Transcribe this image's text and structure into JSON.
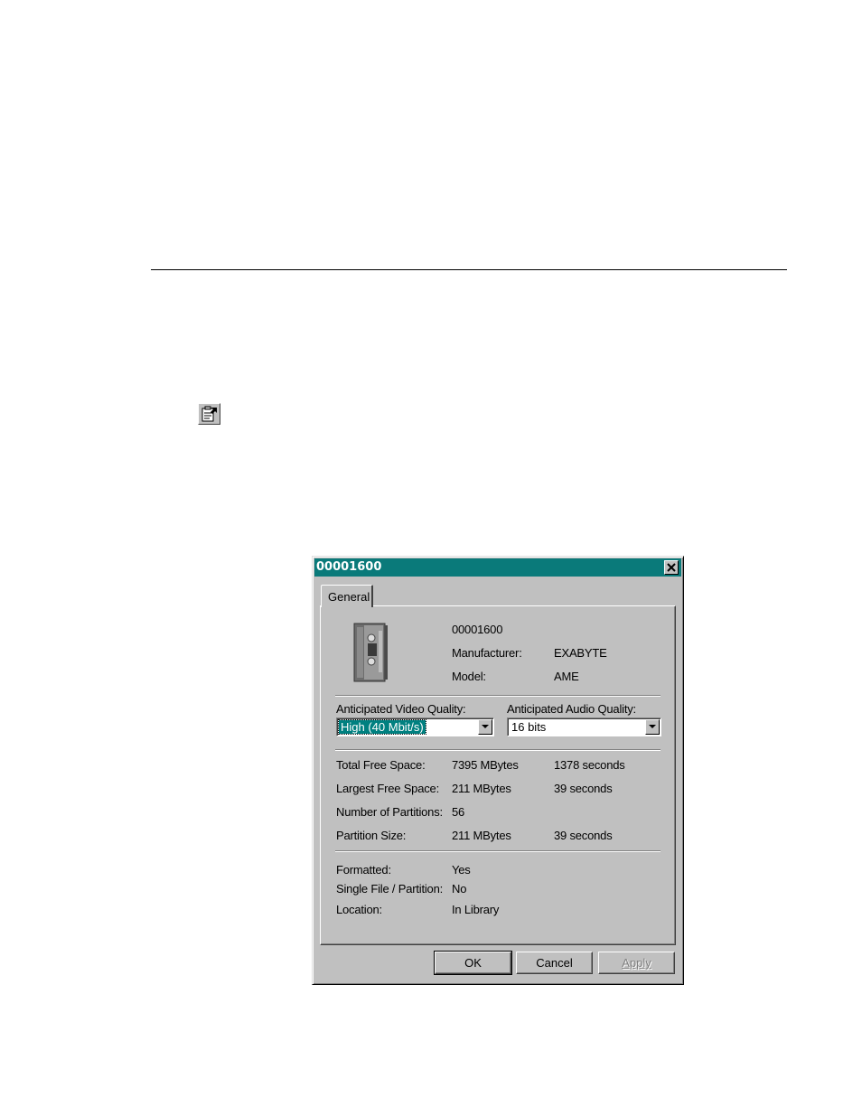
{
  "dialog": {
    "title": "00001600",
    "tab": "General",
    "tape": {
      "id": "00001600",
      "manufacturer_label": "Manufacturer:",
      "manufacturer": "EXABYTE",
      "model_label": "Model:",
      "model": "AME"
    },
    "video_quality": {
      "label": "Anticipated Video Quality:",
      "value": "High (40 Mbit/s)"
    },
    "audio_quality": {
      "label": "Anticipated Audio Quality:",
      "value": "16 bits"
    },
    "space": {
      "total_label": "Total Free Space:",
      "total_size": "7395 MBytes",
      "total_time": "1378 seconds",
      "largest_label": "Largest Free Space:",
      "largest_size": "211 MBytes",
      "largest_time": "39 seconds",
      "partitions_label": "Number of Partitions:",
      "partitions": "56",
      "partition_size_label": "Partition Size:",
      "partition_size": "211 MBytes",
      "partition_time": "39 seconds"
    },
    "status": {
      "formatted_label": "Formatted:",
      "formatted": "Yes",
      "single_label": "Single File / Partition:",
      "single": "No",
      "location_label": "Location:",
      "location": "In Library"
    },
    "buttons": {
      "ok": "OK",
      "cancel": "Cancel",
      "apply": "Apply"
    }
  },
  "colors": {
    "title_bar": "#0a7a7a",
    "face": "#c0c0c0",
    "selection": "#008080"
  }
}
